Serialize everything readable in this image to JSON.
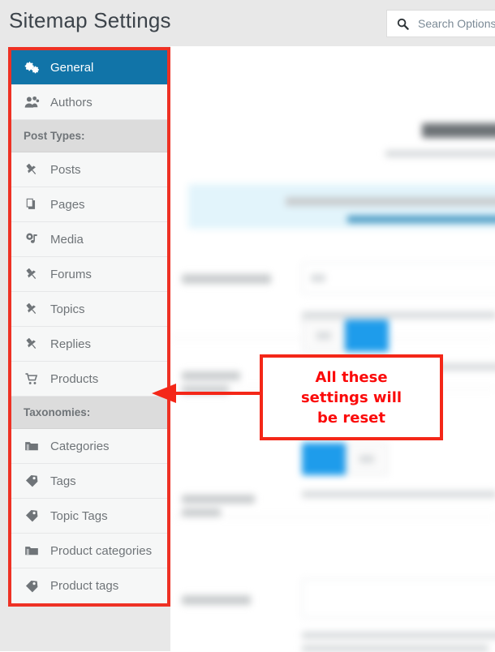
{
  "header": {
    "title": "Sitemap Settings",
    "search": {
      "placeholder": "Search Options",
      "value": "",
      "icon": "search-icon"
    }
  },
  "sidebar": {
    "groups": [
      {
        "type": "items",
        "items": [
          {
            "label": "General",
            "icon": "gears-icon",
            "active": true
          },
          {
            "label": "Authors",
            "icon": "users-icon",
            "active": false
          }
        ]
      },
      {
        "type": "header",
        "label": "Post Types:"
      },
      {
        "type": "items",
        "items": [
          {
            "label": "Posts",
            "icon": "pushpin-icon",
            "active": false
          },
          {
            "label": "Pages",
            "icon": "pages-icon",
            "active": false
          },
          {
            "label": "Media",
            "icon": "media-icon",
            "active": false
          },
          {
            "label": "Forums",
            "icon": "pushpin-icon",
            "active": false
          },
          {
            "label": "Topics",
            "icon": "pushpin-icon",
            "active": false
          },
          {
            "label": "Replies",
            "icon": "pushpin-icon",
            "active": false
          },
          {
            "label": "Products",
            "icon": "cart-icon",
            "active": false
          }
        ]
      },
      {
        "type": "header",
        "label": "Taxonomies:"
      },
      {
        "type": "items",
        "items": [
          {
            "label": "Categories",
            "icon": "folder-icon",
            "active": false
          },
          {
            "label": "Tags",
            "icon": "tag-icon",
            "active": false
          },
          {
            "label": "Topic Tags",
            "icon": "tag-icon",
            "active": false
          },
          {
            "label": "Product categories",
            "icon": "folder-icon",
            "active": false
          },
          {
            "label": "Product tags",
            "icon": "tag-icon",
            "active": false
          }
        ]
      }
    ]
  },
  "annotation": {
    "lines": [
      "All these",
      "settings will",
      "be reset"
    ],
    "color": "#fb0a0a",
    "arrow_direction": "left"
  },
  "colors": {
    "accent_blue": "#1174a8",
    "toggle_blue": "#1e9ceb",
    "annotation_red": "#f42718",
    "sidebar_item_bg": "#f6f7f7",
    "section_header_bg": "#dcdcdc",
    "page_bg": "#e8e8e8"
  }
}
